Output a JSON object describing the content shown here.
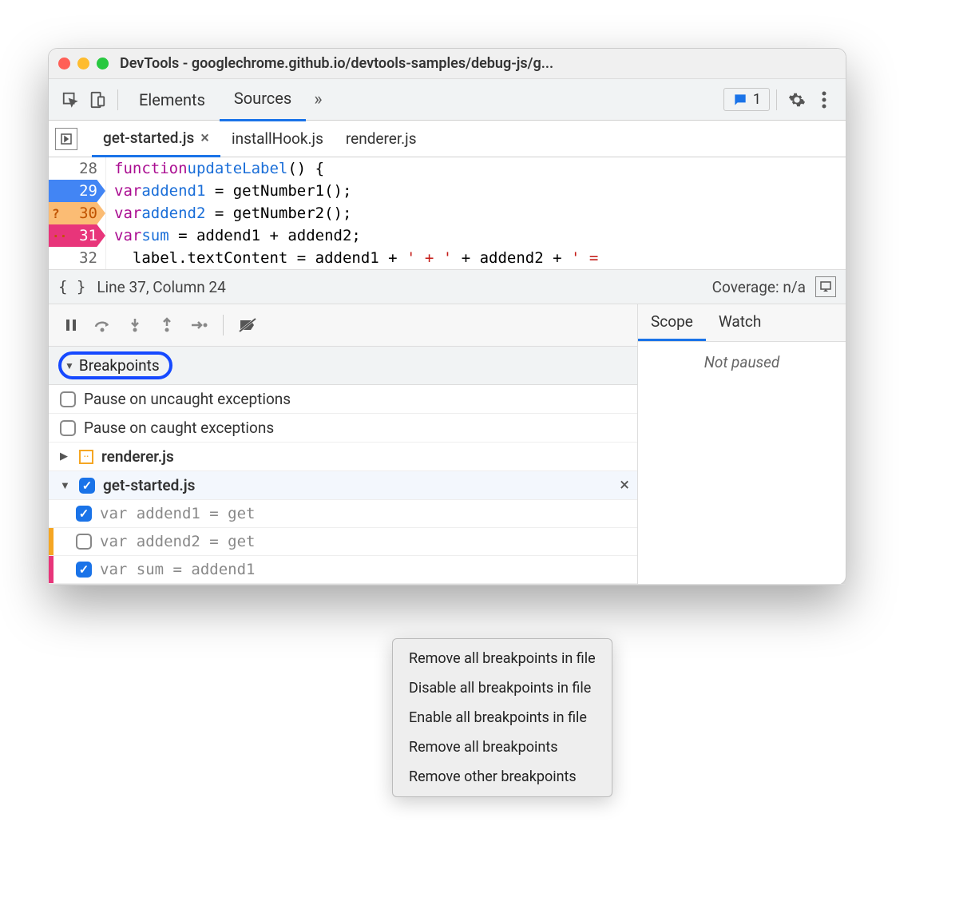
{
  "window": {
    "title": "DevTools - googlechrome.github.io/devtools-samples/debug-js/g..."
  },
  "maintabs": {
    "elements": "Elements",
    "sources": "Sources",
    "feedback_count": "1"
  },
  "filetabs": {
    "tab0": "get-started.js",
    "tab1": "installHook.js",
    "tab2": "renderer.js"
  },
  "code": {
    "lines": [
      {
        "n": "28",
        "bp": "",
        "html": "<span class='kw'>function</span> <span class='fn'>updateLabel</span>() {"
      },
      {
        "n": "29",
        "bp": "blue",
        "html": "  <span class='kw'>var</span> <span class='vr'>addend1</span> = getNumber1();"
      },
      {
        "n": "30",
        "bp": "orange",
        "mark": "?",
        "html": "  <span class='kw'>var</span> <span class='vr'>addend2</span> = getNumber2();"
      },
      {
        "n": "31",
        "bp": "pink",
        "mark": "··",
        "html": "  <span class='kw'>var</span> <span class='vr'>sum</span> = addend1 + addend2;"
      },
      {
        "n": "32",
        "bp": "",
        "html": "  label.textContent = addend1 + <span class='str'>' + '</span> + addend2 + <span class='str'>' =</span>"
      }
    ]
  },
  "status": {
    "cursor": "Line 37, Column 24",
    "coverage": "Coverage: n/a"
  },
  "breakpoints": {
    "section_label": "Breakpoints",
    "pause_uncaught": "Pause on uncaught exceptions",
    "pause_caught": "Pause on caught exceptions",
    "file0": "renderer.js",
    "file1": "get-started.js",
    "bp0": "var addend1 = get",
    "bp1": "var addend2 = get",
    "bp2": "var sum = addend1"
  },
  "right_panel": {
    "tab0": "Scope",
    "tab1": "Watch",
    "not_paused": "Not paused"
  },
  "context_menu": {
    "i0": "Remove all breakpoints in file",
    "i1": "Disable all breakpoints in file",
    "i2": "Enable all breakpoints in file",
    "i3": "Remove all breakpoints",
    "i4": "Remove other breakpoints"
  }
}
